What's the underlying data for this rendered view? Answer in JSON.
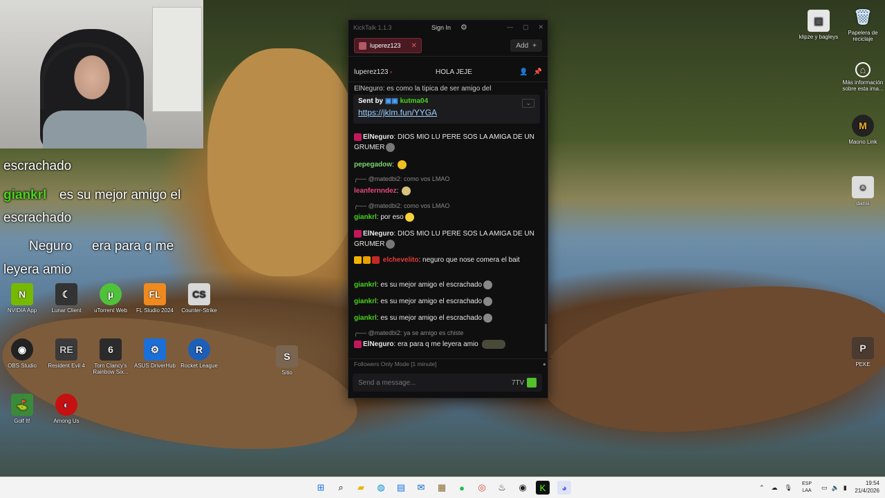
{
  "stream_overlay": {
    "lines": [
      {
        "text": "escrachado",
        "user": ""
      },
      {
        "text": "es su mejor amigo el",
        "user": "giankrl"
      },
      {
        "text": "escrachado",
        "user": ""
      },
      {
        "text": "era para q me",
        "user": "Neguro"
      },
      {
        "text": "leyera amio",
        "user": ""
      }
    ]
  },
  "desktop_icons": [
    {
      "label": "OBS Studio",
      "icon": "obs-icon"
    },
    {
      "label": "Resident Evil 4",
      "icon": "re4-icon"
    },
    {
      "label": "Tom Clancy's Rainbow Six...",
      "icon": "r6-icon"
    },
    {
      "label": "ASUS DriverHub",
      "icon": "asus-icon"
    },
    {
      "label": "Rocket League",
      "icon": "rocket-league-icon"
    },
    {
      "label": "NVIDIA App",
      "icon": "nvidia-icon"
    },
    {
      "label": "Lunar Client",
      "icon": "lunar-icon"
    },
    {
      "label": "uTorrent Web",
      "icon": "utorrent-icon"
    },
    {
      "label": "FL Studio 2024",
      "icon": "fl-studio-icon"
    },
    {
      "label": "Counter-Strike",
      "icon": "cs-icon"
    },
    {
      "label": "Golf It!",
      "icon": "golf-icon"
    },
    {
      "label": "Among Us",
      "icon": "among-us-icon"
    },
    {
      "label": "klipze y bagleys",
      "icon": "folder-icon"
    },
    {
      "label": "Papelera de reciclaje",
      "icon": "recycle-bin-icon"
    },
    {
      "label": "Más información sobre esta ima...",
      "icon": "info-icon"
    },
    {
      "label": "Maono Link",
      "icon": "maono-icon"
    },
    {
      "label": "dansi",
      "icon": "dansi-icon"
    },
    {
      "label": "PEKE",
      "icon": "peke-icon"
    },
    {
      "label": "Sitio",
      "icon": "sitio-icon"
    }
  ],
  "kicktalk": {
    "title": "KickTalk 1.1.3",
    "sign_in": "Sign In",
    "tab_label": "luperez123",
    "add_label": "Add",
    "channel_name": "luperez123",
    "stream_title": "HOLA JEJE",
    "cut_message": "ElNeguro: es como la tipica de ser amigo del",
    "pinned": {
      "sent_by_label": "Sent by",
      "user": "kutma04",
      "link": "https://jklm.fun/YYGA"
    },
    "messages": [
      {
        "kind": "msg",
        "user": "ElNeguro",
        "color": "#e8e8e8",
        "text": "DIOS MIO LU PERE SOS LA AMIGA DE UN GRUMER",
        "badge": "#c2185b"
      },
      {
        "kind": "msg",
        "user": "pepegadow",
        "color": "#7bd66b",
        "text": "",
        "badge": ""
      },
      {
        "kind": "reply",
        "text": "@matedbi2: como vos LMAO"
      },
      {
        "kind": "msg",
        "user": "leanfernndez",
        "color": "#e64a7a",
        "text": "",
        "badge": ""
      },
      {
        "kind": "reply",
        "text": "@matedbi2: como vos LMAO"
      },
      {
        "kind": "msg",
        "user": "giankrl",
        "color": "#4ad31d",
        "text": "por eso",
        "badge": ""
      },
      {
        "kind": "msg",
        "user": "ElNeguro",
        "color": "#e8e8e8",
        "text": "DIOS MIO LU PERE SOS LA AMIGA DE UN GRUMER",
        "badge": "#c2185b"
      },
      {
        "kind": "msg",
        "user": "elchevelito",
        "color": "#e53935",
        "text": "neguro que nose comera el bait",
        "badge": "#f0b400"
      },
      {
        "kind": "msg",
        "user": "giankrl",
        "color": "#4ad31d",
        "text": "es su mejor amigo el escrachado",
        "badge": ""
      },
      {
        "kind": "msg",
        "user": "giankrl",
        "color": "#4ad31d",
        "text": "es su mejor amigo el escrachado",
        "badge": ""
      },
      {
        "kind": "msg",
        "user": "giankrl",
        "color": "#4ad31d",
        "text": "es su mejor amigo el escrachado",
        "badge": ""
      },
      {
        "kind": "reply",
        "text": "@matedbi2: ya se amigo es chiste"
      },
      {
        "kind": "msg",
        "user": "ElNeguro",
        "color": "#e8e8e8",
        "text": "era para q me leyera amio",
        "badge": "#c2185b"
      }
    ],
    "mode_text": "Followers Only Mode [1 minute]",
    "input_placeholder": "Send a message..."
  },
  "taskbar": {
    "lang_top": "ESP",
    "lang_bottom": "LAA",
    "time": "19:54",
    "date": "21/4/2026"
  }
}
